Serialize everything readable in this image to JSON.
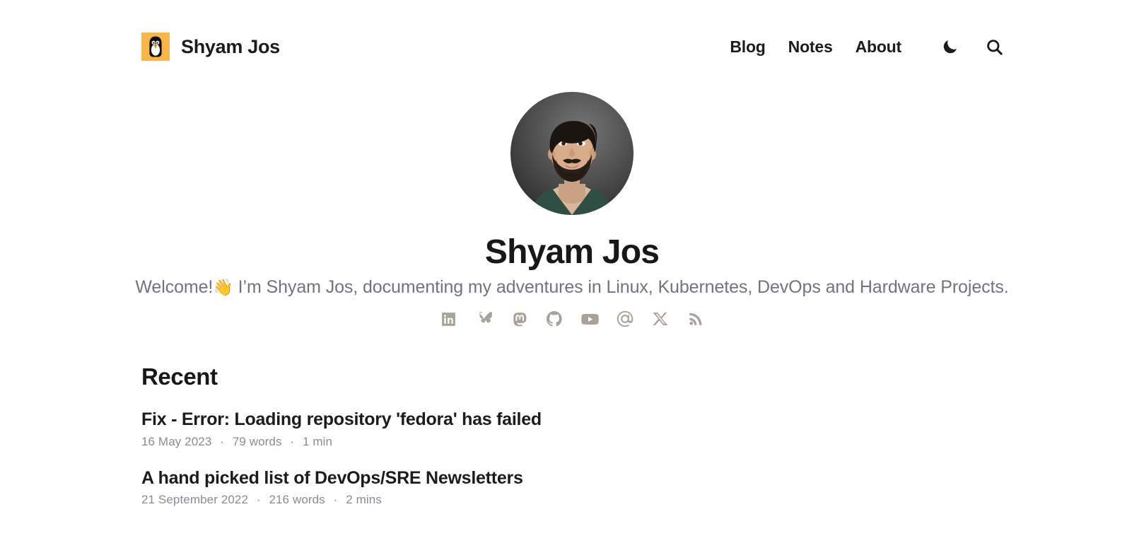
{
  "site": {
    "brand_name": "Shyam Jos",
    "logo_icon": "penguin-logo-icon",
    "logo_bg": "#f9b44c"
  },
  "nav": {
    "items": [
      {
        "label": "Blog"
      },
      {
        "label": "Notes"
      },
      {
        "label": "About"
      }
    ],
    "dark_mode_icon": "moon-icon",
    "search_icon": "search-icon"
  },
  "profile": {
    "avatar_icon": "profile-avatar",
    "name": "Shyam Jos",
    "tagline_prefix": "Welcome!",
    "tagline_emoji": "👋",
    "tagline_rest": " I’m Shyam Jos, documenting my adventures in Linux, Kubernetes, DevOps and Hardware Projects.",
    "socials": [
      {
        "name": "linkedin",
        "icon": "linkedin-icon"
      },
      {
        "name": "bluesky",
        "icon": "bluesky-icon"
      },
      {
        "name": "mastodon",
        "icon": "mastodon-icon"
      },
      {
        "name": "github",
        "icon": "github-icon"
      },
      {
        "name": "youtube",
        "icon": "youtube-icon"
      },
      {
        "name": "email",
        "icon": "email-icon"
      },
      {
        "name": "x-twitter",
        "icon": "x-twitter-icon"
      },
      {
        "name": "rss",
        "icon": "rss-icon"
      }
    ],
    "social_color": "#a8a29b"
  },
  "recent": {
    "heading": "Recent",
    "posts": [
      {
        "title": "Fix - Error: Loading repository 'fedora' has failed",
        "date": "16 May 2023",
        "words": "79 words",
        "read_time": "1 min"
      },
      {
        "title": "A hand picked list of DevOps/SRE Newsletters",
        "date": "21 September 2022",
        "words": "216 words",
        "read_time": "2 mins"
      }
    ],
    "separator": "·"
  }
}
